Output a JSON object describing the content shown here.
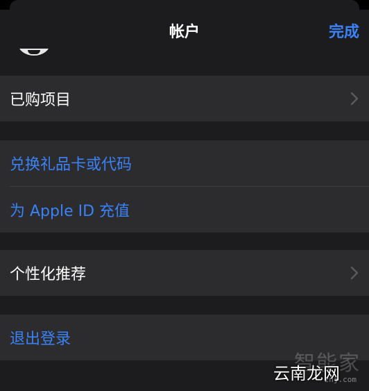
{
  "nav": {
    "title": "帐户",
    "done_label": "完成"
  },
  "purchases": {
    "label": "已购项目",
    "icon": "chevron-right-icon"
  },
  "redeem": {
    "gift_card_label": "兑换礼品卡或代码",
    "add_funds_label": "为 Apple ID 充值"
  },
  "personalization": {
    "label": "个性化推荐",
    "icon": "chevron-right-icon"
  },
  "signout": {
    "label": "退出登录"
  },
  "watermark": {
    "top_text": "智能家",
    "main_text": "云南龙网",
    "small_text": "znj.com"
  },
  "colors": {
    "background": "#1c1c1e",
    "cell": "#2c2c2e",
    "link": "#3a82f7",
    "text": "#ffffff",
    "chevron": "#5a5a5e"
  }
}
